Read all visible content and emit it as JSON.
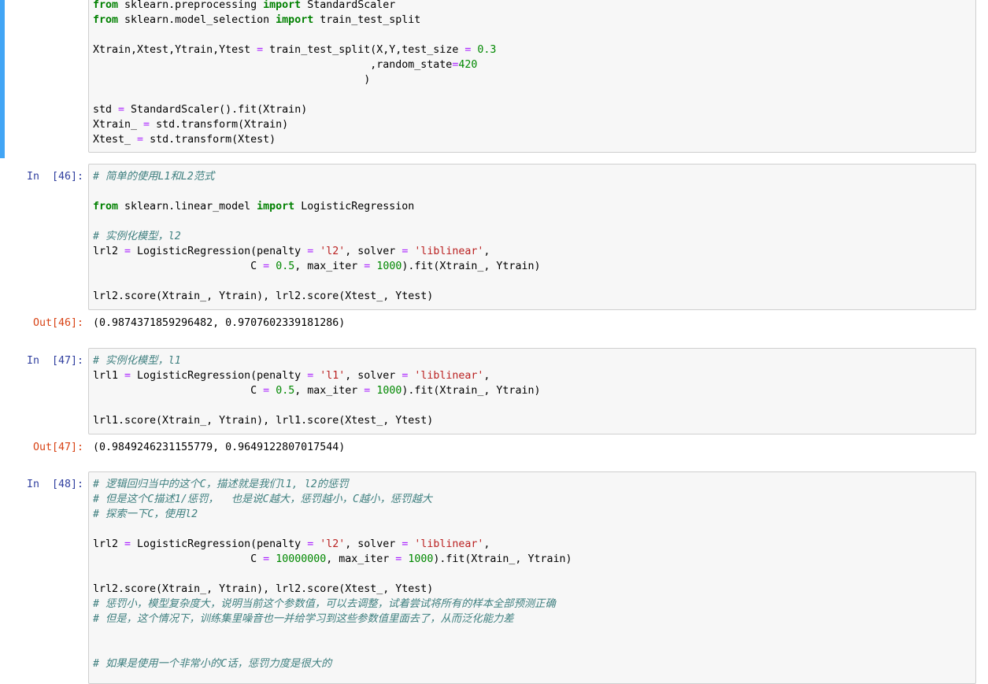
{
  "cells": [
    {
      "type": "code",
      "prompt": "",
      "lines": [
        [
          {
            "t": "from",
            "c": "kw"
          },
          {
            "t": " sklearn.preprocessing "
          },
          {
            "t": "import",
            "c": "kw"
          },
          {
            "t": " StandardScaler"
          }
        ],
        [
          {
            "t": "from",
            "c": "kw"
          },
          {
            "t": " sklearn.model_selection "
          },
          {
            "t": "import",
            "c": "kw"
          },
          {
            "t": " train_test_split"
          }
        ],
        [],
        [
          {
            "t": "Xtrain,Xtest,Ytrain,Ytest "
          },
          {
            "t": "=",
            "c": "op"
          },
          {
            "t": " train_test_split(X,Y,test_size "
          },
          {
            "t": "=",
            "c": "op"
          },
          {
            "t": " "
          },
          {
            "t": "0.3",
            "c": "num"
          }
        ],
        [
          {
            "t": "                                            ,random_state"
          },
          {
            "t": "=",
            "c": "op"
          },
          {
            "t": "420",
            "c": "num"
          }
        ],
        [
          {
            "t": "                                           )"
          }
        ],
        [],
        [
          {
            "t": "std "
          },
          {
            "t": "=",
            "c": "op"
          },
          {
            "t": " StandardScaler().fit(Xtrain)"
          }
        ],
        [
          {
            "t": "Xtrain_ "
          },
          {
            "t": "=",
            "c": "op"
          },
          {
            "t": " std.transform(Xtrain)"
          }
        ],
        [
          {
            "t": "Xtest_ "
          },
          {
            "t": "=",
            "c": "op"
          },
          {
            "t": " std.transform(Xtest)"
          }
        ]
      ]
    },
    {
      "type": "code",
      "prompt": "In  [46]:",
      "lines": [
        [
          {
            "t": "# 简单的使用L1和L2范式",
            "c": "cm"
          }
        ],
        [],
        [
          {
            "t": "from",
            "c": "kw"
          },
          {
            "t": " sklearn.linear_model "
          },
          {
            "t": "import",
            "c": "kw"
          },
          {
            "t": " LogisticRegression"
          }
        ],
        [],
        [
          {
            "t": "# 实例化模型，l2",
            "c": "cm"
          }
        ],
        [
          {
            "t": "lrl2 "
          },
          {
            "t": "=",
            "c": "op"
          },
          {
            "t": " LogisticRegression(penalty "
          },
          {
            "t": "=",
            "c": "op"
          },
          {
            "t": " "
          },
          {
            "t": "'l2'",
            "c": "str"
          },
          {
            "t": ", solver "
          },
          {
            "t": "=",
            "c": "op"
          },
          {
            "t": " "
          },
          {
            "t": "'liblinear'",
            "c": "str"
          },
          {
            "t": ","
          }
        ],
        [
          {
            "t": "                         C "
          },
          {
            "t": "=",
            "c": "op"
          },
          {
            "t": " "
          },
          {
            "t": "0.5",
            "c": "num"
          },
          {
            "t": ", max_iter "
          },
          {
            "t": "=",
            "c": "op"
          },
          {
            "t": " "
          },
          {
            "t": "1000",
            "c": "num"
          },
          {
            "t": ").fit(Xtrain_, Ytrain)"
          }
        ],
        [],
        [
          {
            "t": "lrl2.score(Xtrain_, Ytrain), lrl2.score(Xtest_, Ytest)"
          }
        ]
      ],
      "out_prompt": "Out[46]:",
      "output": "(0.9874371859296482, 0.9707602339181286)"
    },
    {
      "type": "code",
      "prompt": "In  [47]:",
      "lines": [
        [
          {
            "t": "# 实例化模型，l1",
            "c": "cm"
          }
        ],
        [
          {
            "t": "lrl1 "
          },
          {
            "t": "=",
            "c": "op"
          },
          {
            "t": " LogisticRegression(penalty "
          },
          {
            "t": "=",
            "c": "op"
          },
          {
            "t": " "
          },
          {
            "t": "'l1'",
            "c": "str"
          },
          {
            "t": ", solver "
          },
          {
            "t": "=",
            "c": "op"
          },
          {
            "t": " "
          },
          {
            "t": "'liblinear'",
            "c": "str"
          },
          {
            "t": ","
          }
        ],
        [
          {
            "t": "                         C "
          },
          {
            "t": "=",
            "c": "op"
          },
          {
            "t": " "
          },
          {
            "t": "0.5",
            "c": "num"
          },
          {
            "t": ", max_iter "
          },
          {
            "t": "=",
            "c": "op"
          },
          {
            "t": " "
          },
          {
            "t": "1000",
            "c": "num"
          },
          {
            "t": ").fit(Xtrain_, Ytrain)"
          }
        ],
        [],
        [
          {
            "t": "lrl1.score(Xtrain_, Ytrain), lrl1.score(Xtest_, Ytest)"
          }
        ]
      ],
      "out_prompt": "Out[47]:",
      "output": "(0.9849246231155779, 0.9649122807017544)"
    },
    {
      "type": "code",
      "prompt": "In  [48]:",
      "lines": [
        [
          {
            "t": "# 逻辑回归当中的这个C，描述就是我们l1, l2的惩罚",
            "c": "cm"
          }
        ],
        [
          {
            "t": "# 但是这个C描述1/惩罚，  也是说C越大，惩罚越小，C越小，惩罚越大",
            "c": "cm"
          }
        ],
        [
          {
            "t": "# 探索一下C，使用l2",
            "c": "cm"
          }
        ],
        [],
        [
          {
            "t": "lrl2 "
          },
          {
            "t": "=",
            "c": "op"
          },
          {
            "t": " LogisticRegression(penalty "
          },
          {
            "t": "=",
            "c": "op"
          },
          {
            "t": " "
          },
          {
            "t": "'l2'",
            "c": "str"
          },
          {
            "t": ", solver "
          },
          {
            "t": "=",
            "c": "op"
          },
          {
            "t": " "
          },
          {
            "t": "'liblinear'",
            "c": "str"
          },
          {
            "t": ","
          }
        ],
        [
          {
            "t": "                         C "
          },
          {
            "t": "=",
            "c": "op"
          },
          {
            "t": " "
          },
          {
            "t": "10000000",
            "c": "num"
          },
          {
            "t": ", max_iter "
          },
          {
            "t": "=",
            "c": "op"
          },
          {
            "t": " "
          },
          {
            "t": "1000",
            "c": "num"
          },
          {
            "t": ").fit(Xtrain_, Ytrain)"
          }
        ],
        [],
        [
          {
            "t": "lrl2.score(Xtrain_, Ytrain), lrl2.score(Xtest_, Ytest)"
          }
        ],
        [
          {
            "t": "# 惩罚小，模型复杂度大，说明当前这个参数值，可以去调整，试着尝试将所有的样本全部预测正确",
            "c": "cm"
          }
        ],
        [
          {
            "t": "# 但是，这个情况下，训练集里噪音也一并给学习到这些参数值里面去了，从而泛化能力差",
            "c": "cm"
          }
        ],
        [],
        [],
        [
          {
            "t": "# 如果是使用一个非常小的C话，惩罚力度是很大的",
            "c": "cm"
          }
        ]
      ]
    }
  ]
}
